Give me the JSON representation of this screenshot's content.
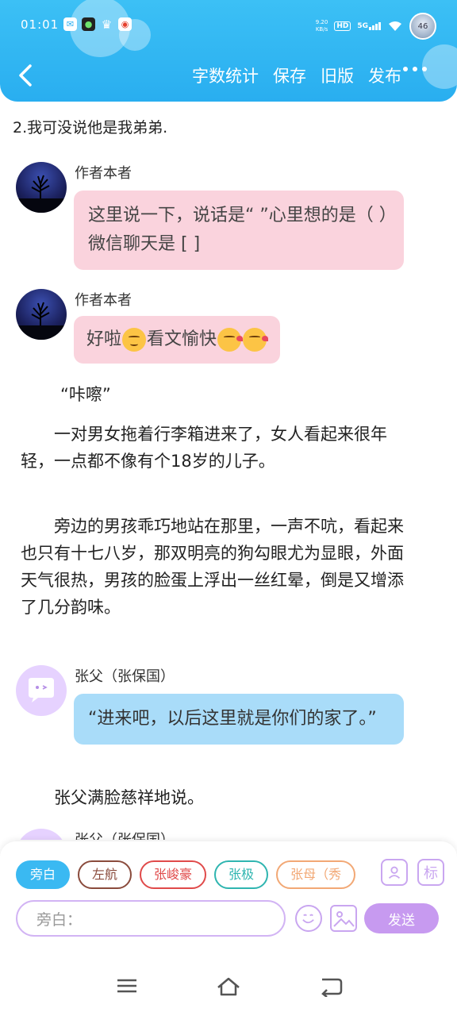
{
  "status": {
    "time": "01:01",
    "net_speed": "9.20\nKB/s",
    "hd": "HD",
    "network": "5G",
    "avatar_text": "46"
  },
  "nav": {
    "back_icon": "chevron-left-icon",
    "actions": [
      "字数统计",
      "保存",
      "旧版",
      "发布"
    ],
    "more_icon": "more-dots-icon"
  },
  "content": {
    "top_line": "2.我可没说他是我弟弟.",
    "messages": [
      {
        "speaker": "作者本者",
        "text": "这里说一下，说话是“ ”心里想的是（ ）微信聊天是 [ ]"
      },
      {
        "speaker": "作者本者",
        "text": "好啦",
        "text_after": "看文愉快"
      }
    ],
    "sound": "“咔嚓”",
    "para1": "一对男女拖着行李箱进来了，女人看起来很年轻，一点都不像有个18岁的儿子。",
    "para2": "旁边的男孩乖巧地站在那里，一声不吭，看起来也只有十七八岁，那双明亮的狗勾眼尤为显眼，外面天气很热，男孩的脸蛋上浮出一丝红晕，倒是又增添了几分韵味。",
    "zhang_msg": {
      "speaker": "张父（张保国）",
      "text": "“进来吧，以后这里就是你们的家了。”"
    },
    "para3": "张父满脸慈祥地说。",
    "cut_speaker": "张父（张保国）"
  },
  "composer": {
    "chips": [
      "旁白",
      "左航",
      "张峻豪",
      "张极",
      "张母（秀"
    ],
    "input_placeholder": "旁白：",
    "send_label": "发送",
    "tag_label": "标"
  },
  "colors": {
    "header": "#29aef0",
    "pink_bubble": "#fad3dd",
    "blue_bubble": "#a9dcf9",
    "send": "#c79af0"
  }
}
